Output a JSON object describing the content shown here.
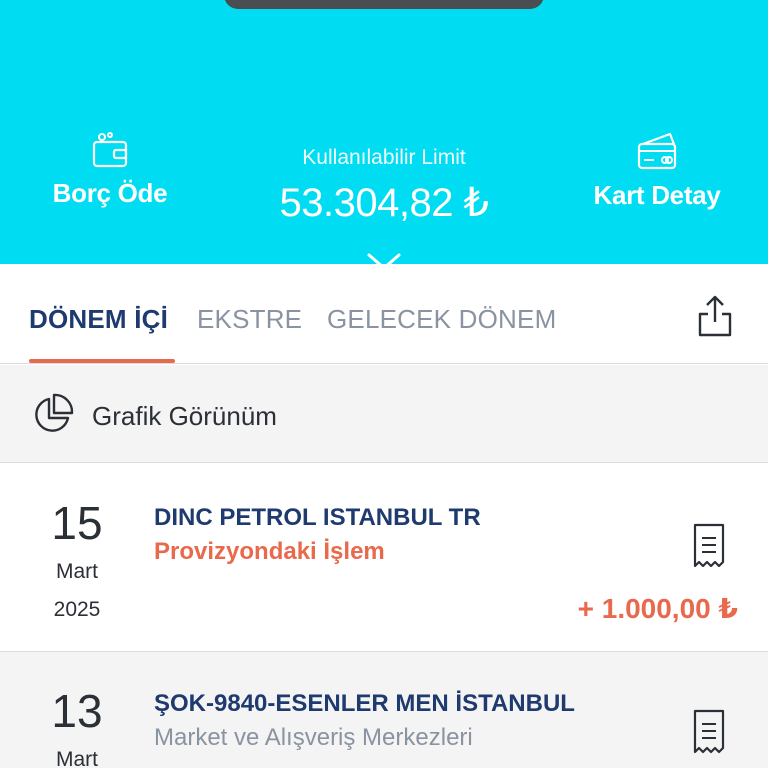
{
  "header": {
    "actions": {
      "left": {
        "label": "Borç Öde",
        "icon": "wallet-icon"
      },
      "right": {
        "label": "Kart Detay",
        "icon": "card-detail-icon"
      }
    },
    "limit": {
      "caption": "Kullanılabilir Limit",
      "amount": "53.304,82 ₺"
    },
    "expand_icon": "chevron-down-icon",
    "accent": "#00dcf2"
  },
  "tabs": {
    "items": [
      {
        "label": "DÖNEM İÇİ",
        "active": true
      },
      {
        "label": "EKSTRE",
        "active": false
      },
      {
        "label": "GELECEK DÖNEM",
        "active": false
      }
    ],
    "share_icon": "share-icon",
    "active_color": "#1e3a6e",
    "underline_color": "#e8694b"
  },
  "chart_view": {
    "label": "Grafik Görünüm",
    "icon": "pie-chart-icon"
  },
  "transactions": [
    {
      "day": "15",
      "month": "Mart",
      "year": "2025",
      "merchant": "DINC PETROL ISTANBUL TR",
      "status": "Provizyondaki İşlem",
      "amount": "+ 1.000,00 ₺",
      "icon": "receipt-icon"
    },
    {
      "day": "13",
      "month": "Mart",
      "merchant": "ŞOK-9840-ESENLER MEN İSTANBUL",
      "category": "Market ve Alışveriş Merkezleri",
      "icon": "receipt-icon"
    }
  ]
}
